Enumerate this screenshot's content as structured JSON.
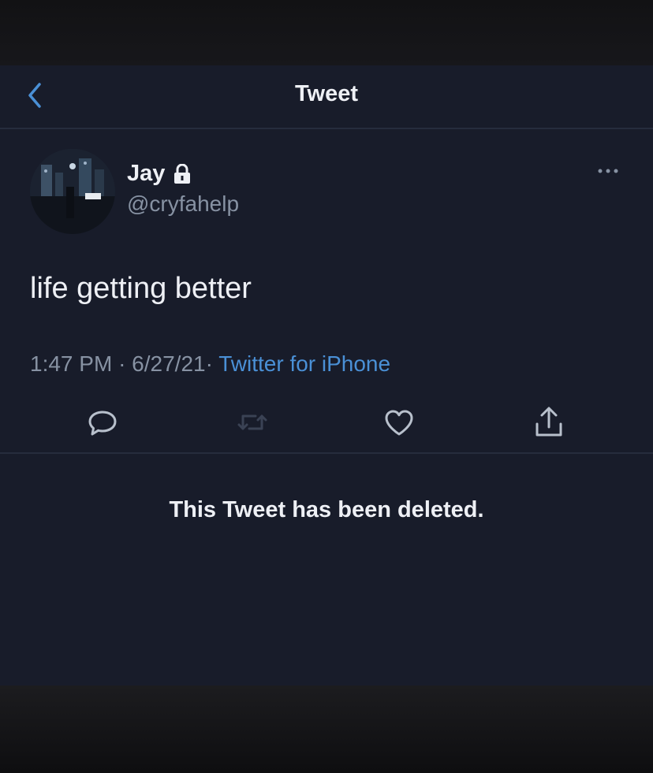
{
  "header": {
    "title": "Tweet",
    "back_icon": "chevron-left-icon"
  },
  "author": {
    "display_name": "Jay",
    "lock_icon": "lock-icon",
    "handle": "@cryfahelp"
  },
  "tweet": {
    "text": "life getting better",
    "time": "1:47 PM",
    "separator": "·",
    "date": "6/27/21",
    "source": "Twitter for iPhone"
  },
  "actions": [
    {
      "icon": "reply-icon"
    },
    {
      "icon": "retweet-icon"
    },
    {
      "icon": "like-icon"
    },
    {
      "icon": "share-icon"
    }
  ],
  "reply_notice": "This Tweet has been deleted.",
  "colors": {
    "background": "#181c2a",
    "text": "#eef0f5",
    "muted": "#8792a3",
    "accent": "#4a90d6",
    "divider": "#262c3d"
  }
}
